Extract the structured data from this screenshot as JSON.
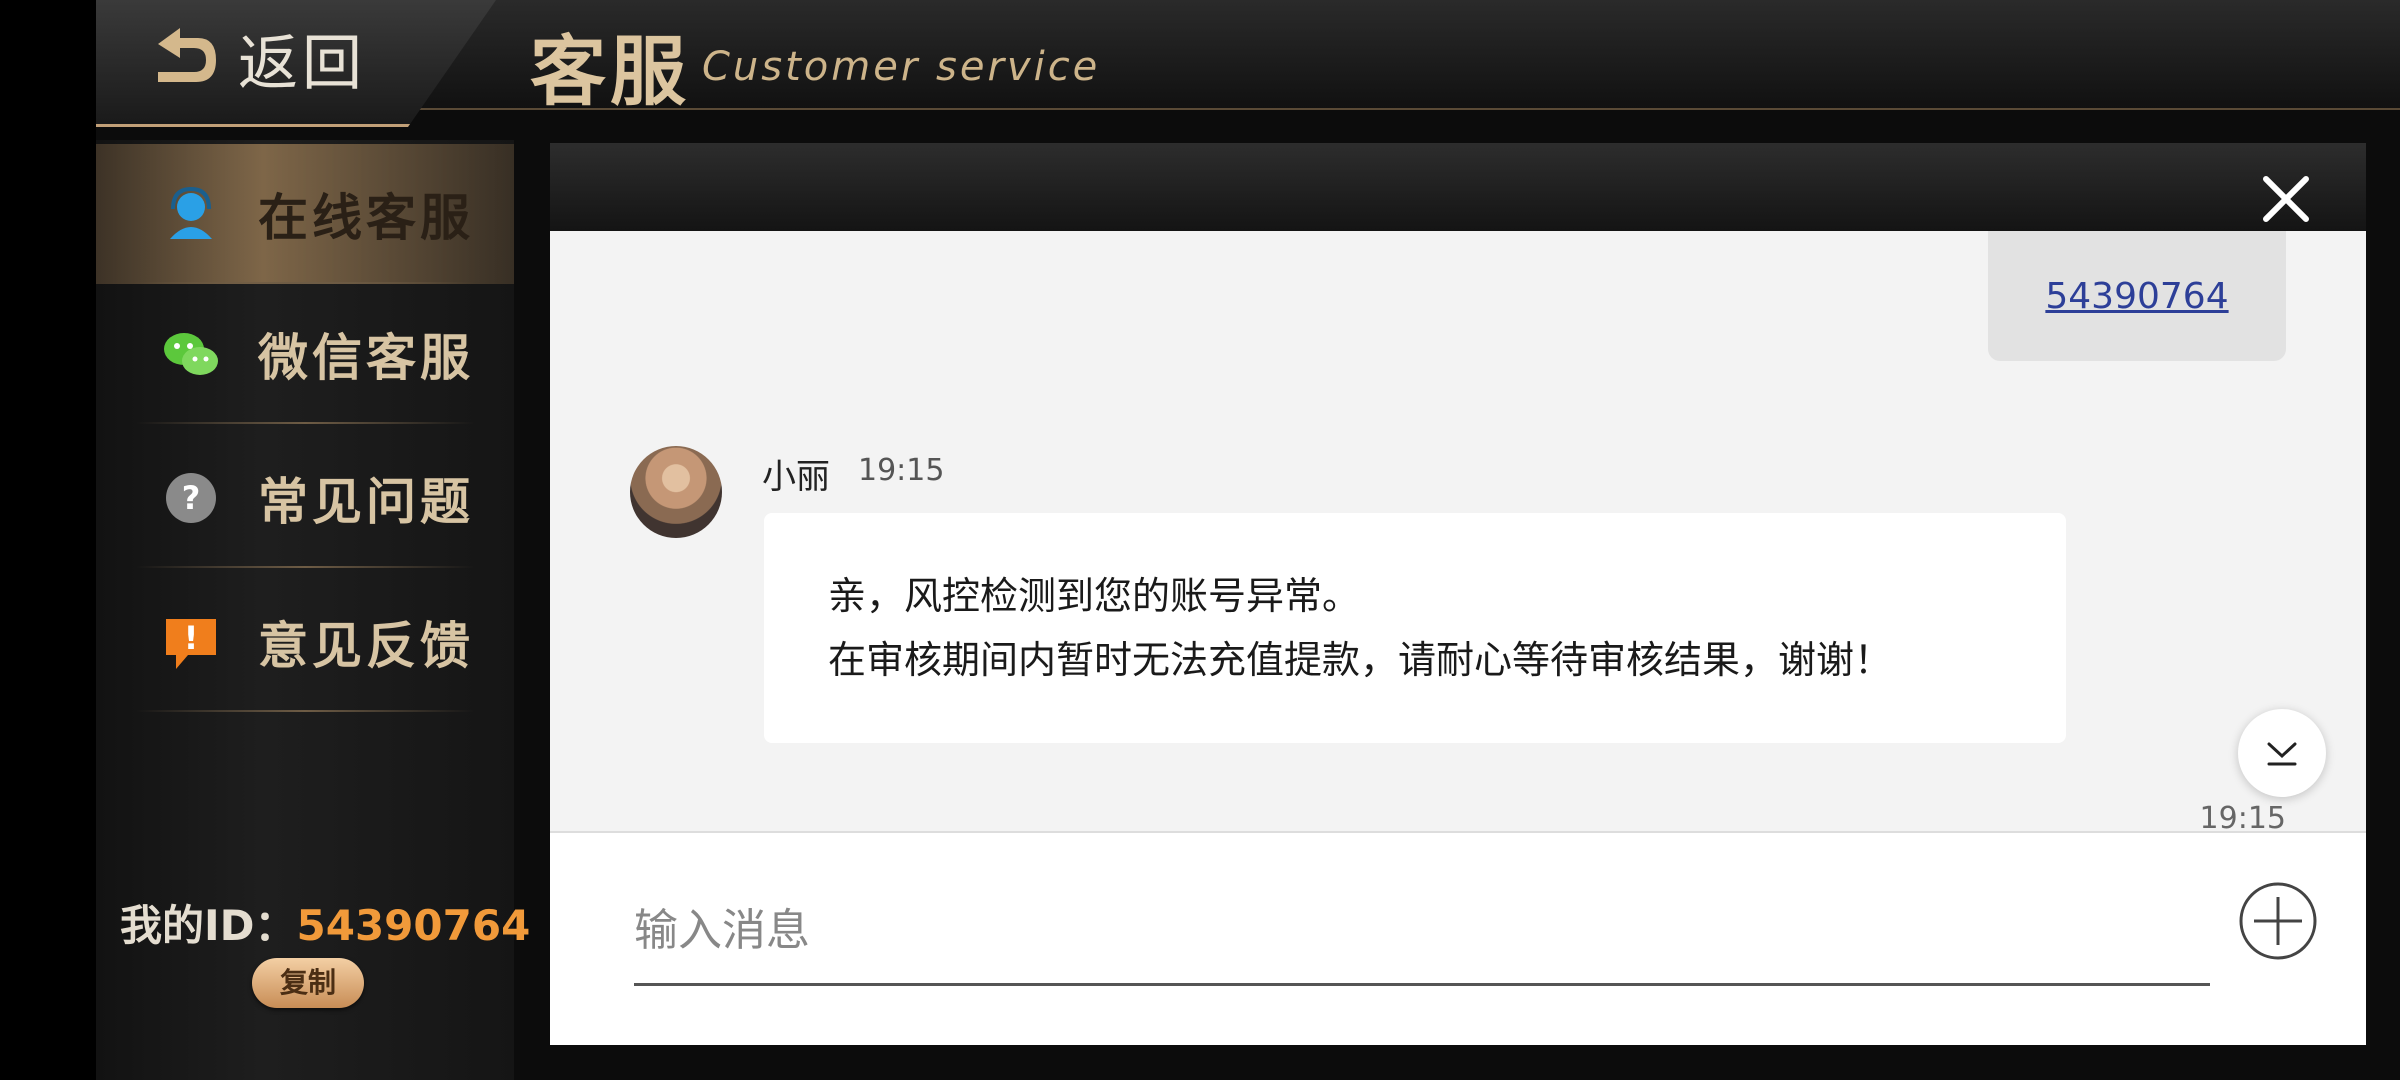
{
  "header": {
    "back_label": "返回",
    "title_cn": "客服",
    "title_en": "Customer service"
  },
  "sidebar": {
    "items": [
      {
        "label": "在线客服",
        "icon": "headset-icon",
        "active": true
      },
      {
        "label": "微信客服",
        "icon": "wechat-icon",
        "active": false
      },
      {
        "label": "常见问题",
        "icon": "question-icon",
        "active": false
      },
      {
        "label": "意见反馈",
        "icon": "feedback-icon",
        "active": false
      }
    ],
    "my_id_label": "我的ID：",
    "my_id_value": "54390764",
    "copy_label": "复制"
  },
  "chat": {
    "user_message_link": "54390764",
    "agent_name": "小丽",
    "agent_time": "19:15",
    "agent_message_lines": [
      "亲，风控检测到您的账号异常。",
      "在审核期间内暂时无法充值提款，请耐心等待审核结果，谢谢！"
    ],
    "footer_time": "19:15",
    "input_placeholder": "输入消息"
  },
  "colors": {
    "accent_gold": "#dcc59f",
    "id_orange": "#f19a3a",
    "link_blue": "#2d3f98"
  }
}
